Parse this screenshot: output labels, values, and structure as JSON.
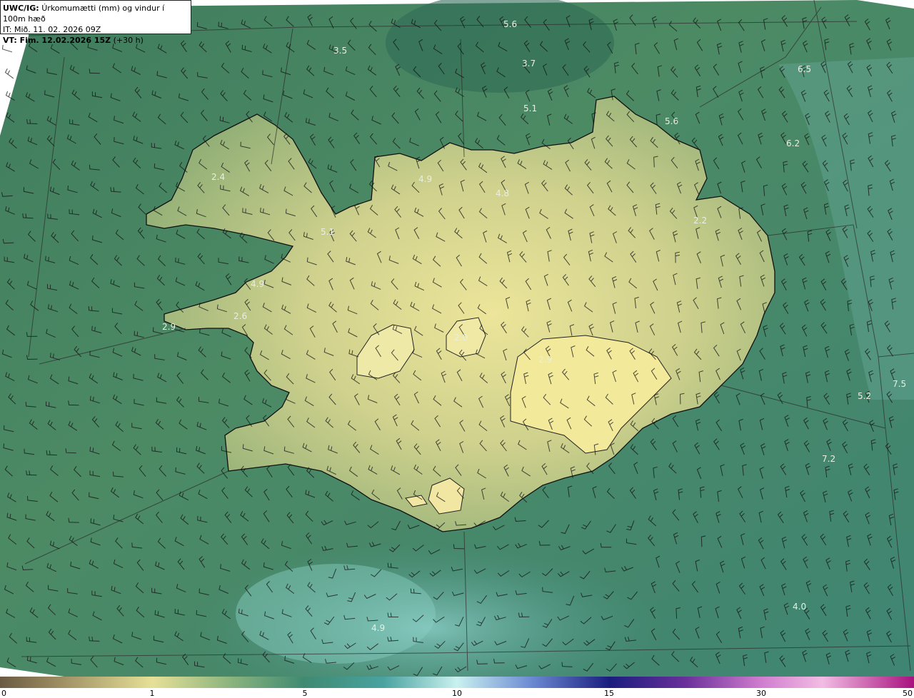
{
  "header": {
    "product": "UWC/IG:",
    "description": "Úrkomumætti (mm) og vindur í 100m hæð",
    "it_label": "IT:",
    "it_value": "Mið. 11. 02. 2026 09Z",
    "vt_label": "VT:",
    "vt_value": "Fim. 12.02.2026 15Z",
    "vt_lead": "(+30 h)"
  },
  "colors": {
    "ocean_dark": "#2f6f5a",
    "ocean_mid": "#4f8a66",
    "land_low": "#9fb779",
    "land_high": "#e3e29a",
    "ocean_light": "#6fb3ad",
    "coast": "#1a1a1a"
  },
  "colorbar": {
    "ticks": [
      "0",
      "1",
      "5",
      "10",
      "15",
      "30",
      "50"
    ]
  },
  "map_values": [
    "5.6",
    "3.5",
    "3.7",
    "6.5",
    "5.1",
    "5.6",
    "6.2",
    "2.4",
    "4.9",
    "4.8",
    "5.1",
    "2.2",
    "4.9",
    "2.6",
    "2.9",
    "2.0",
    "2.9",
    "5.2",
    "7.5",
    "7.2",
    "4.0",
    "4.9"
  ]
}
